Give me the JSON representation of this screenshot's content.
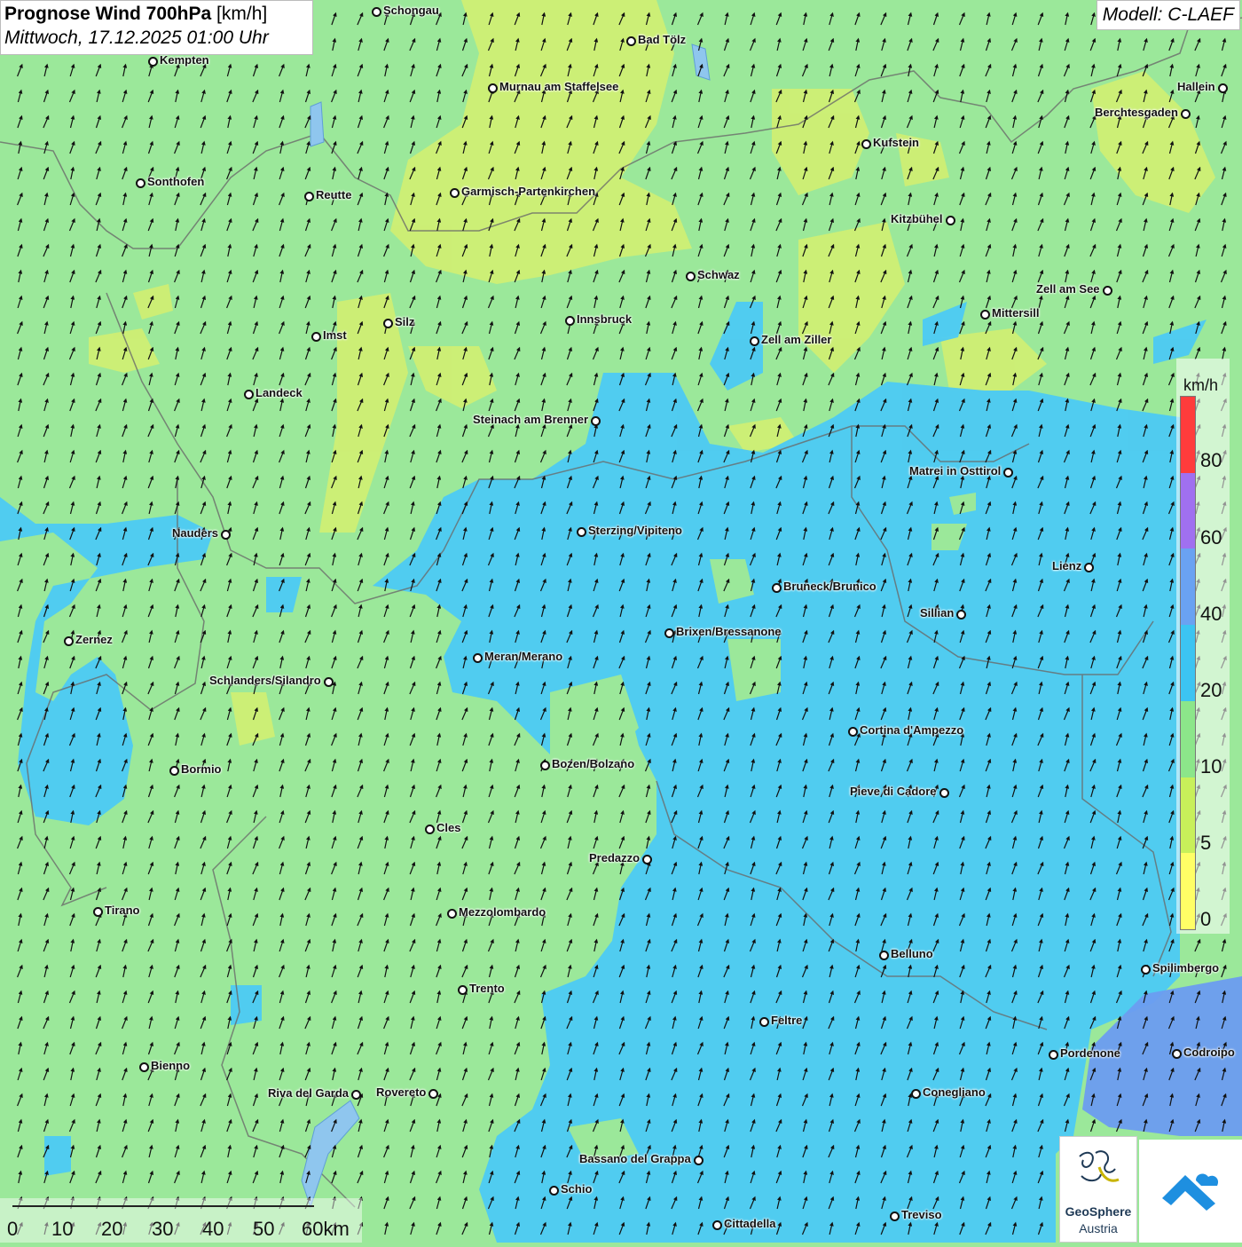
{
  "title": {
    "main": "Prognose Wind 700hPa",
    "unit": "[km/h]",
    "datetime": "Mittwoch, 17.12.2025 01:00 Uhr"
  },
  "model": "Modell: C-LAEF",
  "legend": {
    "unit": "km/h",
    "ticks": [
      "80",
      "60",
      "40",
      "20",
      "10",
      "5",
      "0"
    ],
    "colors": [
      "#ff3c3c",
      "#a070f0",
      "#6aa2f2",
      "#3cc4f2",
      "#8ce68a",
      "#c8f05a",
      "#ffff66"
    ]
  },
  "scale": {
    "labels": [
      "0",
      "10",
      "20",
      "30",
      "40",
      "50",
      "60km"
    ]
  },
  "logo": {
    "name_line1": "GeoSphere",
    "name_line2": "Austria"
  },
  "wind_field": {
    "arrow_direction": "north-northeast",
    "dominant_speed_north": "10-20 km/h",
    "dominant_speed_south": "20-40 km/h"
  },
  "cities": [
    {
      "name": "Schongau",
      "dot": "left"
    },
    {
      "name": "Bad Tölz",
      "dot": "left"
    },
    {
      "name": "Kempten",
      "dot": "left"
    },
    {
      "name": "Murnau am Staffelsee",
      "dot": "left"
    },
    {
      "name": "Hallein",
      "dot": "right"
    },
    {
      "name": "Berchtesgaden",
      "dot": "right"
    },
    {
      "name": "Kufstein",
      "dot": "left"
    },
    {
      "name": "Sonthofen",
      "dot": "left"
    },
    {
      "name": "Reutte",
      "dot": "left"
    },
    {
      "name": "Garmisch-Partenkirchen",
      "dot": "left"
    },
    {
      "name": "Kitzbühel",
      "dot": "right"
    },
    {
      "name": "Schwaz",
      "dot": "left"
    },
    {
      "name": "Zell am See",
      "dot": "right"
    },
    {
      "name": "Mittersill",
      "dot": "left"
    },
    {
      "name": "Innsbruck",
      "dot": "left"
    },
    {
      "name": "Silz",
      "dot": "left"
    },
    {
      "name": "Imst",
      "dot": "left"
    },
    {
      "name": "Zell am Ziller",
      "dot": "left"
    },
    {
      "name": "Landeck",
      "dot": "left"
    },
    {
      "name": "Steinach am Brenner",
      "dot": "right"
    },
    {
      "name": "Matrei in Osttirol",
      "dot": "right"
    },
    {
      "name": "Nauders",
      "dot": "right"
    },
    {
      "name": "Sterzing/Vipiteno",
      "dot": "left"
    },
    {
      "name": "Lienz",
      "dot": "right"
    },
    {
      "name": "Bruneck/Brunico",
      "dot": "left"
    },
    {
      "name": "Sillian",
      "dot": "right"
    },
    {
      "name": "Zernez",
      "dot": "left"
    },
    {
      "name": "Brixen/Bressanone",
      "dot": "left"
    },
    {
      "name": "Meran/Merano",
      "dot": "left"
    },
    {
      "name": "Schlanders/Silandro",
      "dot": "right"
    },
    {
      "name": "Cortina d'Ampezzo",
      "dot": "left"
    },
    {
      "name": "Bozen/Bolzano",
      "dot": "left"
    },
    {
      "name": "Bormio",
      "dot": "left"
    },
    {
      "name": "Pieve di Cadore",
      "dot": "right"
    },
    {
      "name": "Cles",
      "dot": "left"
    },
    {
      "name": "Predazzo",
      "dot": "right"
    },
    {
      "name": "Tirano",
      "dot": "left"
    },
    {
      "name": "Mezzolombardo",
      "dot": "left"
    },
    {
      "name": "Belluno",
      "dot": "left"
    },
    {
      "name": "Spilimbergo",
      "dot": "left"
    },
    {
      "name": "Trento",
      "dot": "left"
    },
    {
      "name": "Feltre",
      "dot": "left"
    },
    {
      "name": "Pordenone",
      "dot": "left"
    },
    {
      "name": "Codroipo",
      "dot": "left"
    },
    {
      "name": "Bienno",
      "dot": "left"
    },
    {
      "name": "Riva del Garda",
      "dot": "right"
    },
    {
      "name": "Rovereto",
      "dot": "right"
    },
    {
      "name": "Conegliano",
      "dot": "left"
    },
    {
      "name": "Bassano del Grappa",
      "dot": "right"
    },
    {
      "name": "Schio",
      "dot": "left"
    },
    {
      "name": "Treviso",
      "dot": "left"
    },
    {
      "name": "Cittadella",
      "dot": "left"
    }
  ]
}
